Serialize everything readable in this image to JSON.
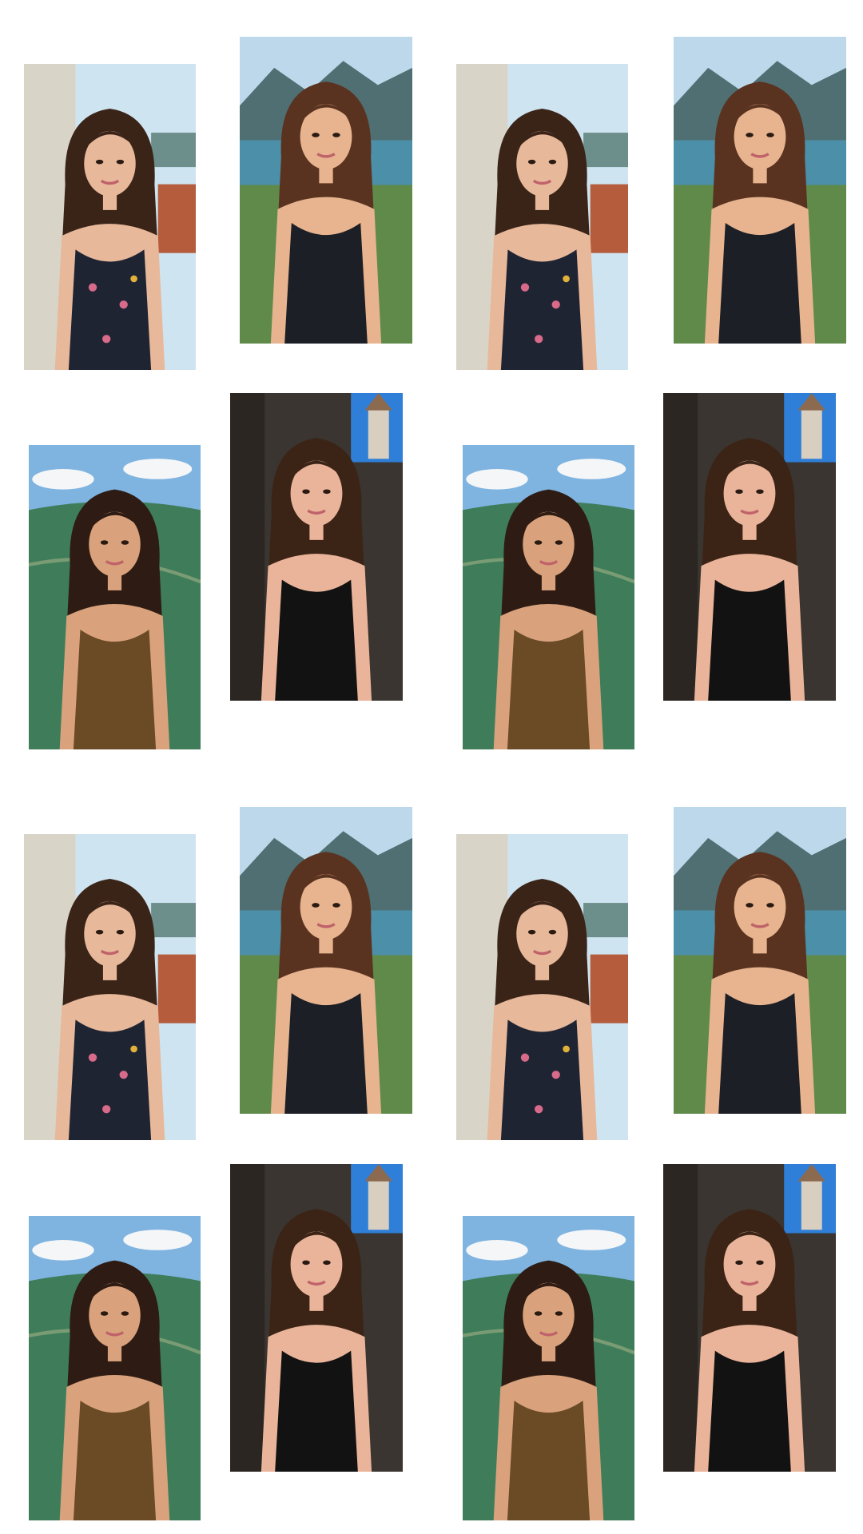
{
  "gallery": {
    "photos": [
      {
        "id": 1,
        "scene": "balcony",
        "colors": {
          "sky": "#cfe4f1",
          "wall": "#d9d4c8",
          "roof": "#b45c3c",
          "hair": "#3a2418",
          "skin": "#e8b89a",
          "top": "#1f2433",
          "accent": "#d86a8a"
        }
      },
      {
        "id": 2,
        "scene": "lake-mountains",
        "colors": {
          "sky": "#bcd8ea",
          "mountain": "#4f6f73",
          "water": "#4c8fa8",
          "hair": "#5a3320",
          "skin": "#e7b48f",
          "top": "#1d1f27"
        }
      },
      {
        "id": 3,
        "scene": "balcony",
        "colors": {
          "sky": "#cfe4f1",
          "wall": "#d9d4c8",
          "roof": "#b45c3c",
          "hair": "#3a2418",
          "skin": "#e8b89a",
          "top": "#1f2433",
          "accent": "#d86a8a"
        }
      },
      {
        "id": 4,
        "scene": "lake-mountains",
        "colors": {
          "sky": "#bcd8ea",
          "mountain": "#4f6f73",
          "water": "#4c8fa8",
          "hair": "#5a3320",
          "skin": "#e7b48f",
          "top": "#1d1f27"
        }
      },
      {
        "id": 5,
        "scene": "valley-overlook",
        "colors": {
          "sky": "#7fb3e0",
          "cloud": "#f4f6f8",
          "hill": "#3f7d5a",
          "hair": "#2e1c14",
          "skin": "#d9a27c",
          "top": "#6b4a26"
        }
      },
      {
        "id": 6,
        "scene": "town-tower",
        "colors": {
          "sky": "#2f7fd8",
          "tower": "#d8cfc0",
          "hair": "#3b2416",
          "skin": "#eab49a",
          "top": "#121212"
        }
      },
      {
        "id": 7,
        "scene": "valley-overlook",
        "colors": {
          "sky": "#7fb3e0",
          "cloud": "#f4f6f8",
          "hill": "#3f7d5a",
          "hair": "#2e1c14",
          "skin": "#d9a27c",
          "top": "#6b4a26"
        }
      },
      {
        "id": 8,
        "scene": "town-tower",
        "colors": {
          "sky": "#2f7fd8",
          "tower": "#d8cfc0",
          "hair": "#3b2416",
          "skin": "#eab49a",
          "top": "#121212"
        }
      },
      {
        "id": 9,
        "scene": "balcony",
        "colors": {
          "sky": "#cfe4f1",
          "wall": "#d9d4c8",
          "roof": "#b45c3c",
          "hair": "#3a2418",
          "skin": "#e8b89a",
          "top": "#1f2433",
          "accent": "#d86a8a"
        }
      },
      {
        "id": 10,
        "scene": "lake-mountains",
        "colors": {
          "sky": "#bcd8ea",
          "mountain": "#4f6f73",
          "water": "#4c8fa8",
          "hair": "#5a3320",
          "skin": "#e7b48f",
          "top": "#1d1f27"
        }
      },
      {
        "id": 11,
        "scene": "balcony",
        "colors": {
          "sky": "#cfe4f1",
          "wall": "#d9d4c8",
          "roof": "#b45c3c",
          "hair": "#3a2418",
          "skin": "#e8b89a",
          "top": "#1f2433",
          "accent": "#d86a8a"
        }
      },
      {
        "id": 12,
        "scene": "lake-mountains",
        "colors": {
          "sky": "#bcd8ea",
          "mountain": "#4f6f73",
          "water": "#4c8fa8",
          "hair": "#5a3320",
          "skin": "#e7b48f",
          "top": "#1d1f27"
        }
      },
      {
        "id": 13,
        "scene": "valley-overlook",
        "colors": {
          "sky": "#7fb3e0",
          "cloud": "#f4f6f8",
          "hill": "#3f7d5a",
          "hair": "#2e1c14",
          "skin": "#d9a27c",
          "top": "#6b4a26"
        }
      },
      {
        "id": 14,
        "scene": "town-tower",
        "colors": {
          "sky": "#2f7fd8",
          "tower": "#d8cfc0",
          "hair": "#3b2416",
          "skin": "#eab49a",
          "top": "#121212"
        }
      },
      {
        "id": 15,
        "scene": "valley-overlook",
        "colors": {
          "sky": "#7fb3e0",
          "cloud": "#f4f6f8",
          "hill": "#3f7d5a",
          "hair": "#2e1c14",
          "skin": "#d9a27c",
          "top": "#6b4a26"
        }
      },
      {
        "id": 16,
        "scene": "town-tower",
        "colors": {
          "sky": "#2f7fd8",
          "tower": "#d8cfc0",
          "hair": "#3b2416",
          "skin": "#eab49a",
          "top": "#121212"
        }
      }
    ]
  }
}
